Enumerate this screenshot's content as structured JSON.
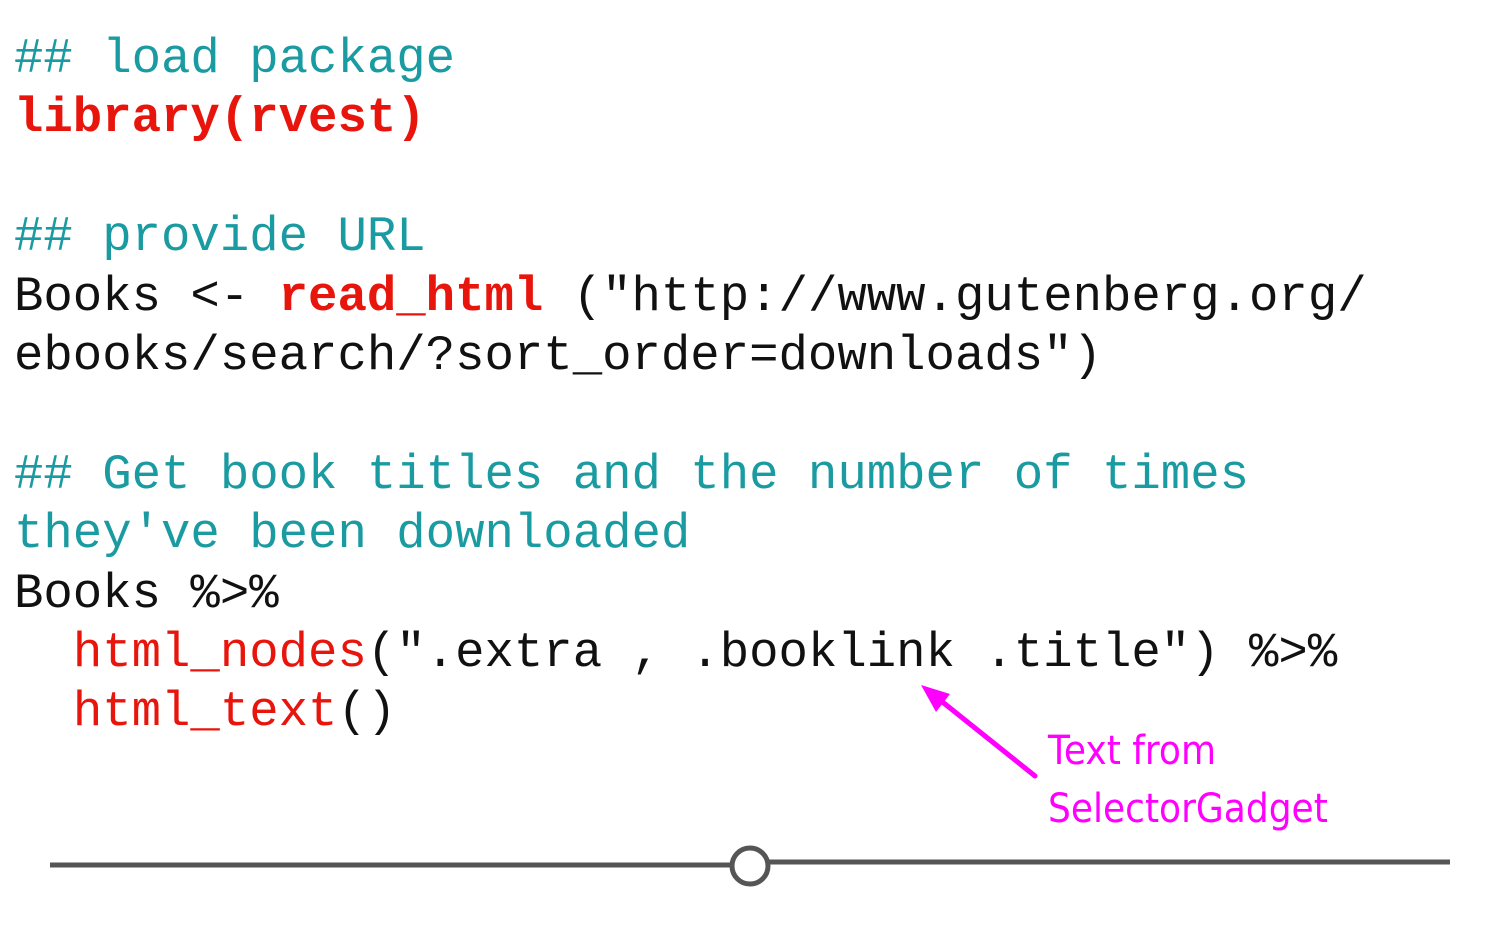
{
  "code": {
    "comment_load": "## load package",
    "library_call": "library(rvest)",
    "comment_url": "## provide URL",
    "books_assign": "Books <- ",
    "read_html_fn": "read_html",
    "read_html_arg_1": " (\"http://www.gutenberg.org/",
    "read_html_arg_2": "ebooks/search/?sort_order=downloads\")",
    "comment_titles_1": "## Get book titles and the number of times",
    "comment_titles_2": "they've been downloaded",
    "books_pipe": "Books %>%",
    "indent": "  ",
    "html_nodes_fn": "html_nodes",
    "html_nodes_args": "(\".extra , .booklink .title\") %>%",
    "html_text_fn": "html_text",
    "html_text_args": "()"
  },
  "annotation": {
    "line_1": "Text from",
    "line_2": "SelectorGadget",
    "color": "#ff00ff"
  },
  "colors": {
    "comment": "#1a9ba1",
    "function": "#e8150d",
    "text": "#111111",
    "divider": "#555555"
  }
}
